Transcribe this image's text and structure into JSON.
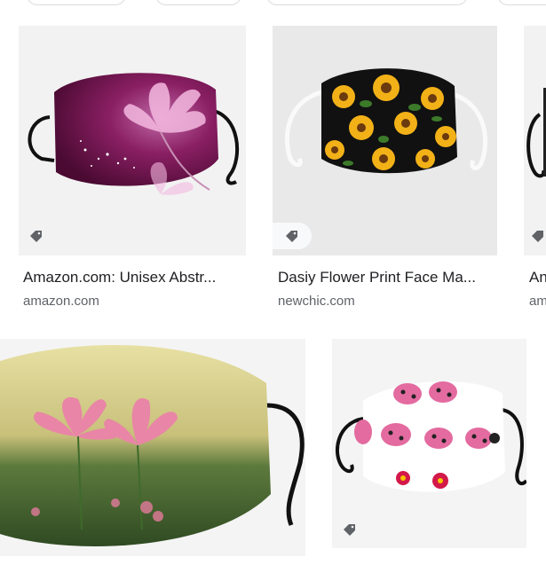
{
  "results": [
    {
      "title": "Amazon.com: Unisex Abstr...",
      "source": "amazon.com",
      "image": "purple flower face mask"
    },
    {
      "title": "Dasiy Flower Print Face Ma...",
      "source": "newchic.com",
      "image": "sunflower face mask"
    },
    {
      "title": "An",
      "source": "am",
      "image": "black face mask (partially visible)"
    },
    {
      "title": "",
      "source": "",
      "image": "lotus flower face mask"
    },
    {
      "title": "",
      "source": "",
      "image": "ladybug face mask"
    }
  ],
  "icons": {
    "tag": "tag-icon"
  },
  "colors": {
    "title_text": "#202124",
    "source_text": "#5f6368",
    "tile_bg": "#f1f1f1"
  }
}
